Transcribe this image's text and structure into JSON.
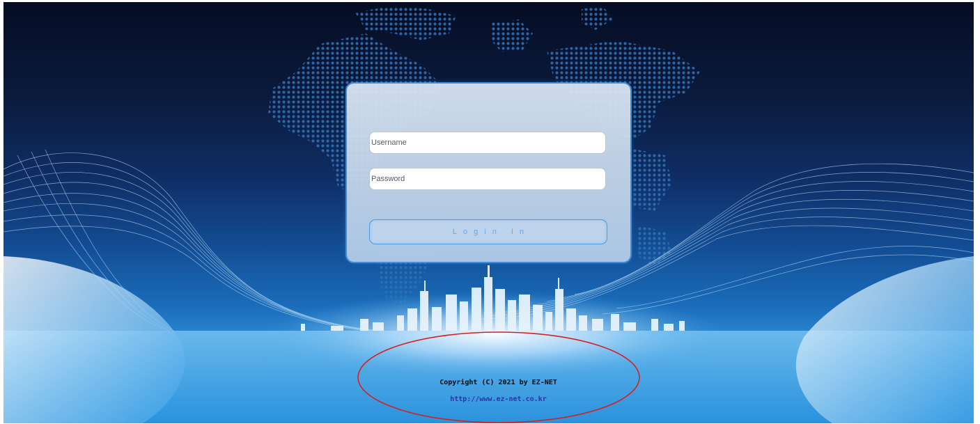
{
  "login": {
    "username_placeholder": "Username",
    "password_placeholder": "Password",
    "button_label": "Login In"
  },
  "footer": {
    "copyright": "Copyright (C) 2021 by EZ-NET",
    "url": "http://www.ez-net.co.kr"
  },
  "colors": {
    "background_top": "#060d24",
    "background_bottom": "#2b8fd8",
    "panel": "#c8d8ec",
    "button_border": "#4a9be0",
    "annotation_ellipse": "#d42020",
    "link": "#3b2ca8"
  }
}
